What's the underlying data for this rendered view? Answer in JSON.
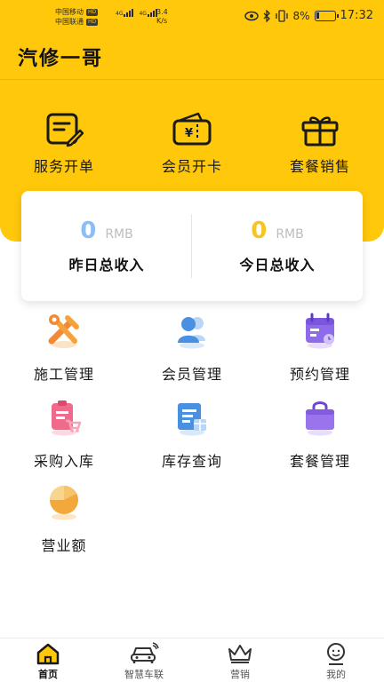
{
  "status_bar": {
    "carrier1": "中国移动",
    "carrier2": "中国联通",
    "hd": "HD",
    "net1": "4G",
    "net2": "4G",
    "speed_value": "3.4",
    "speed_unit": "K/s",
    "battery": "8%",
    "time": "17:32"
  },
  "app": {
    "title": "汽修一哥"
  },
  "quick_actions": [
    {
      "label": "服务开单",
      "icon": "edit-order-icon"
    },
    {
      "label": "会员开卡",
      "icon": "wallet-icon"
    },
    {
      "label": "套餐销售",
      "icon": "gift-icon"
    }
  ],
  "income": {
    "yesterday": {
      "value": "0",
      "unit": "RMB",
      "label": "昨日总收入",
      "color": "#8DBDF5"
    },
    "today": {
      "value": "0",
      "unit": "RMB",
      "label": "今日总收入",
      "color": "#F7C523"
    }
  },
  "grid": [
    {
      "label": "施工管理",
      "icon": "tools-icon"
    },
    {
      "label": "会员管理",
      "icon": "members-icon"
    },
    {
      "label": "预约管理",
      "icon": "calendar-icon"
    },
    {
      "label": "采购入库",
      "icon": "purchase-cart-icon"
    },
    {
      "label": "库存查询",
      "icon": "inventory-icon"
    },
    {
      "label": "套餐管理",
      "icon": "package-bag-icon"
    },
    {
      "label": "营业额",
      "icon": "pie-chart-icon"
    }
  ],
  "bottom_nav": [
    {
      "label": "首页",
      "icon": "home-icon",
      "active": true
    },
    {
      "label": "智慧车联",
      "icon": "car-icon",
      "active": false
    },
    {
      "label": "营销",
      "icon": "crown-icon",
      "active": false
    },
    {
      "label": "我的",
      "icon": "profile-icon",
      "active": false
    }
  ],
  "colors": {
    "brand": "#FFC80A",
    "accent_dark": "#111111"
  }
}
